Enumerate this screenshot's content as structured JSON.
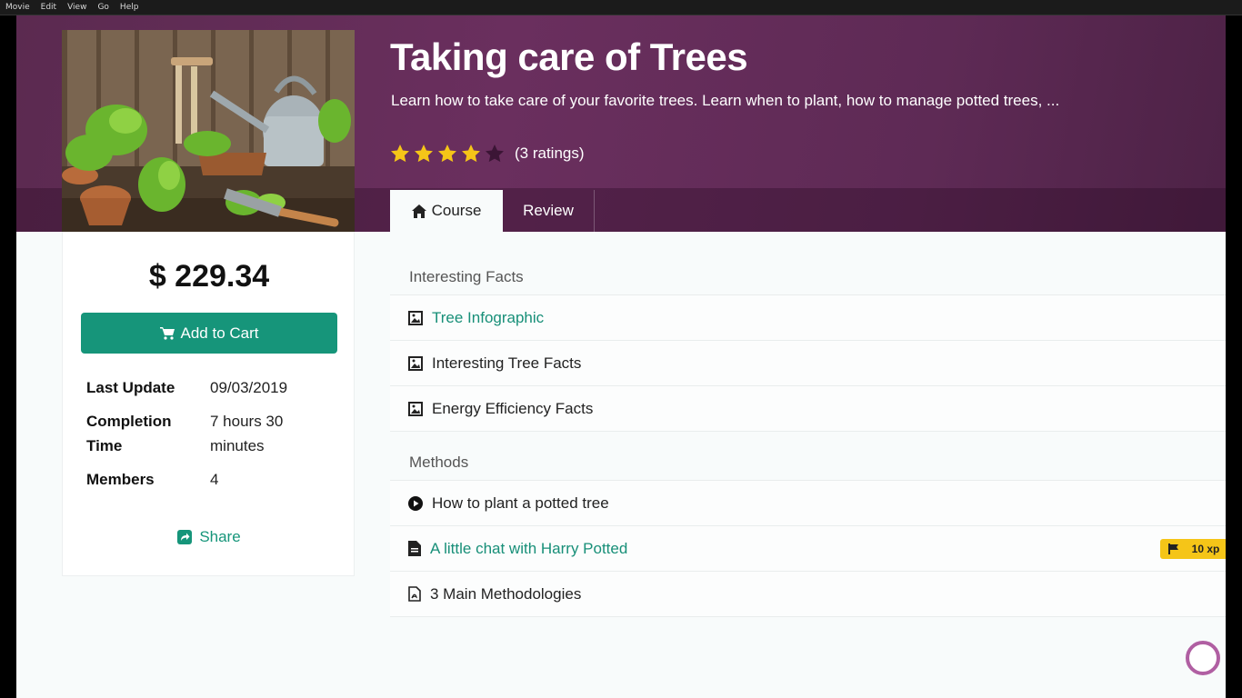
{
  "menubar": {
    "items": [
      "Movie",
      "Edit",
      "View",
      "Go",
      "Help"
    ]
  },
  "course": {
    "title": "Taking care of Trees",
    "description": "Learn how to take care of your favorite trees. Learn when to plant, how to manage potted trees, ...",
    "rating": {
      "stars_filled": 4,
      "stars_total": 5,
      "text": "(3 ratings)"
    }
  },
  "tabs": [
    {
      "label": "Course",
      "icon": "home-icon",
      "active": true
    },
    {
      "label": "Review",
      "active": false
    }
  ],
  "sidebar": {
    "price": "$ 229.34",
    "add_to_cart": "Add to Cart",
    "info": [
      {
        "label": "Last Update",
        "value": "09/03/2019"
      },
      {
        "label": "Completion Time",
        "value": "7 hours 30 minutes"
      },
      {
        "label": "Members",
        "value": "4"
      }
    ],
    "share": "Share"
  },
  "sections": [
    {
      "title": "Interesting Facts",
      "items": [
        {
          "label": "Tree Infographic",
          "icon": "image-icon",
          "link": true
        },
        {
          "label": "Interesting Tree Facts",
          "icon": "image-icon",
          "link": false
        },
        {
          "label": "Energy Efficiency Facts",
          "icon": "image-icon",
          "link": false
        }
      ]
    },
    {
      "title": "Methods",
      "items": [
        {
          "label": "How to plant a potted tree",
          "icon": "play-icon",
          "link": false
        },
        {
          "label": "A little chat with Harry Potted",
          "icon": "document-icon",
          "link": true,
          "badge": "10 xp"
        },
        {
          "label": "3 Main Methodologies",
          "icon": "pdf-icon",
          "link": false
        }
      ]
    }
  ],
  "colors": {
    "hero": "#5b2a50",
    "accent": "#16957a",
    "badge": "#f5c518",
    "star": "#f5c518"
  }
}
